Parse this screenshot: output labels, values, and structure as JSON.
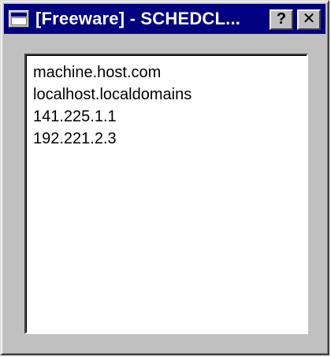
{
  "window": {
    "title": "[Freeware] - SCHEDCL...",
    "help_label": "?",
    "close_label": "✕"
  },
  "hosts": [
    "machine.host.com",
    "localhost.localdomains",
    "141.225.1.1",
    "192.221.2.3"
  ],
  "colors": {
    "titlebar": "#000080",
    "face": "#c0c0c0",
    "client": "#ffffff"
  },
  "icons": {
    "app": "window-app-icon",
    "help": "help-icon",
    "close": "close-icon"
  }
}
